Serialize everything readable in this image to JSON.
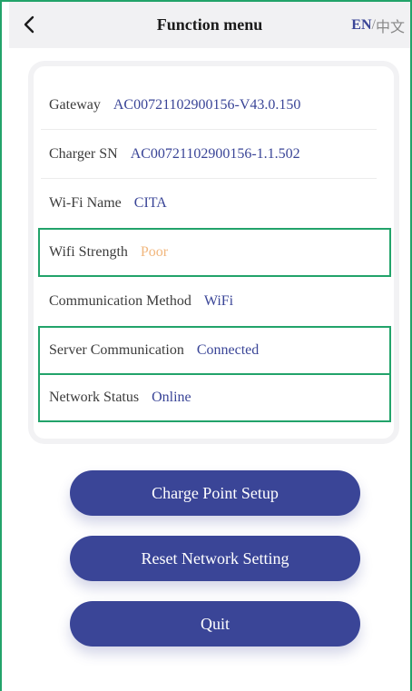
{
  "header": {
    "title": "Function menu",
    "lang_en": "EN",
    "lang_sep": "/",
    "lang_zh": "中文"
  },
  "info_rows": [
    {
      "label": "Gateway",
      "value": "AC00721102900156-V43.0.150"
    },
    {
      "label": "Charger SN",
      "value": "AC00721102900156-1.1.502"
    },
    {
      "label": "Wi-Fi Name",
      "value": "CITA"
    },
    {
      "label": "Wifi Strength",
      "value": "Poor"
    },
    {
      "label": "Communication Method",
      "value": "WiFi"
    },
    {
      "label": "Server Communication",
      "value": "Connected"
    },
    {
      "label": "Network Status",
      "value": "Online"
    }
  ],
  "buttons": {
    "charge_point_setup": "Charge Point Setup",
    "reset_network": "Reset Network Setting",
    "quit": "Quit"
  },
  "colors": {
    "accent": "#3a4597",
    "highlight_border": "#22a36a",
    "poor": "#f1b77e"
  }
}
